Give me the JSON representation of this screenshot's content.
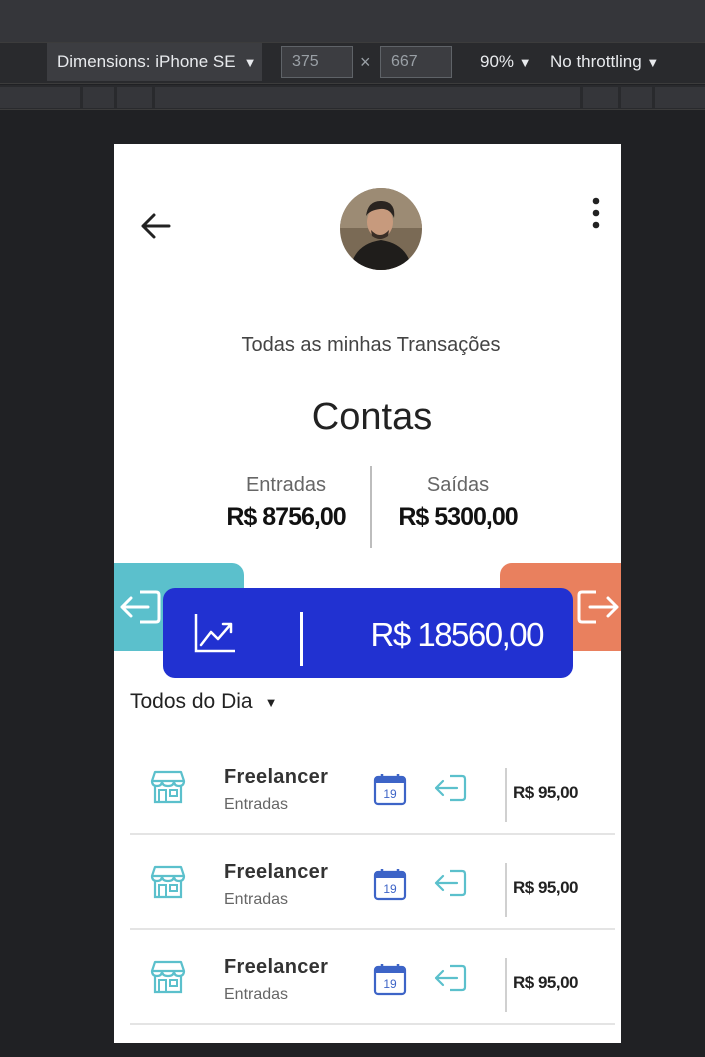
{
  "devtools": {
    "device_label": "Dimensions: iPhone SE",
    "width": "375",
    "height": "667",
    "zoom": "90%",
    "throttling": "No throttling"
  },
  "header": {
    "subtitle": "Todas as minhas Transações",
    "title": "Contas"
  },
  "summary": {
    "income_label": "Entradas",
    "income_value": "R$ 8756,00",
    "expense_label": "Saídas",
    "expense_value": "R$ 5300,00"
  },
  "total": {
    "value": "R$ 18560,00"
  },
  "filter": {
    "label": "Todos do Dia"
  },
  "transactions": [
    {
      "name": "Freelancer",
      "type": "Entradas",
      "day": "19",
      "amount": "R$ 95,00"
    },
    {
      "name": "Freelancer",
      "type": "Entradas",
      "day": "19",
      "amount": "R$ 95,00"
    },
    {
      "name": "Freelancer",
      "type": "Entradas",
      "day": "19",
      "amount": "R$ 95,00"
    }
  ],
  "colors": {
    "primary": "#2131d1",
    "income": "#5bc0cc",
    "expense": "#e9805e",
    "calendar": "#3d64c7"
  }
}
